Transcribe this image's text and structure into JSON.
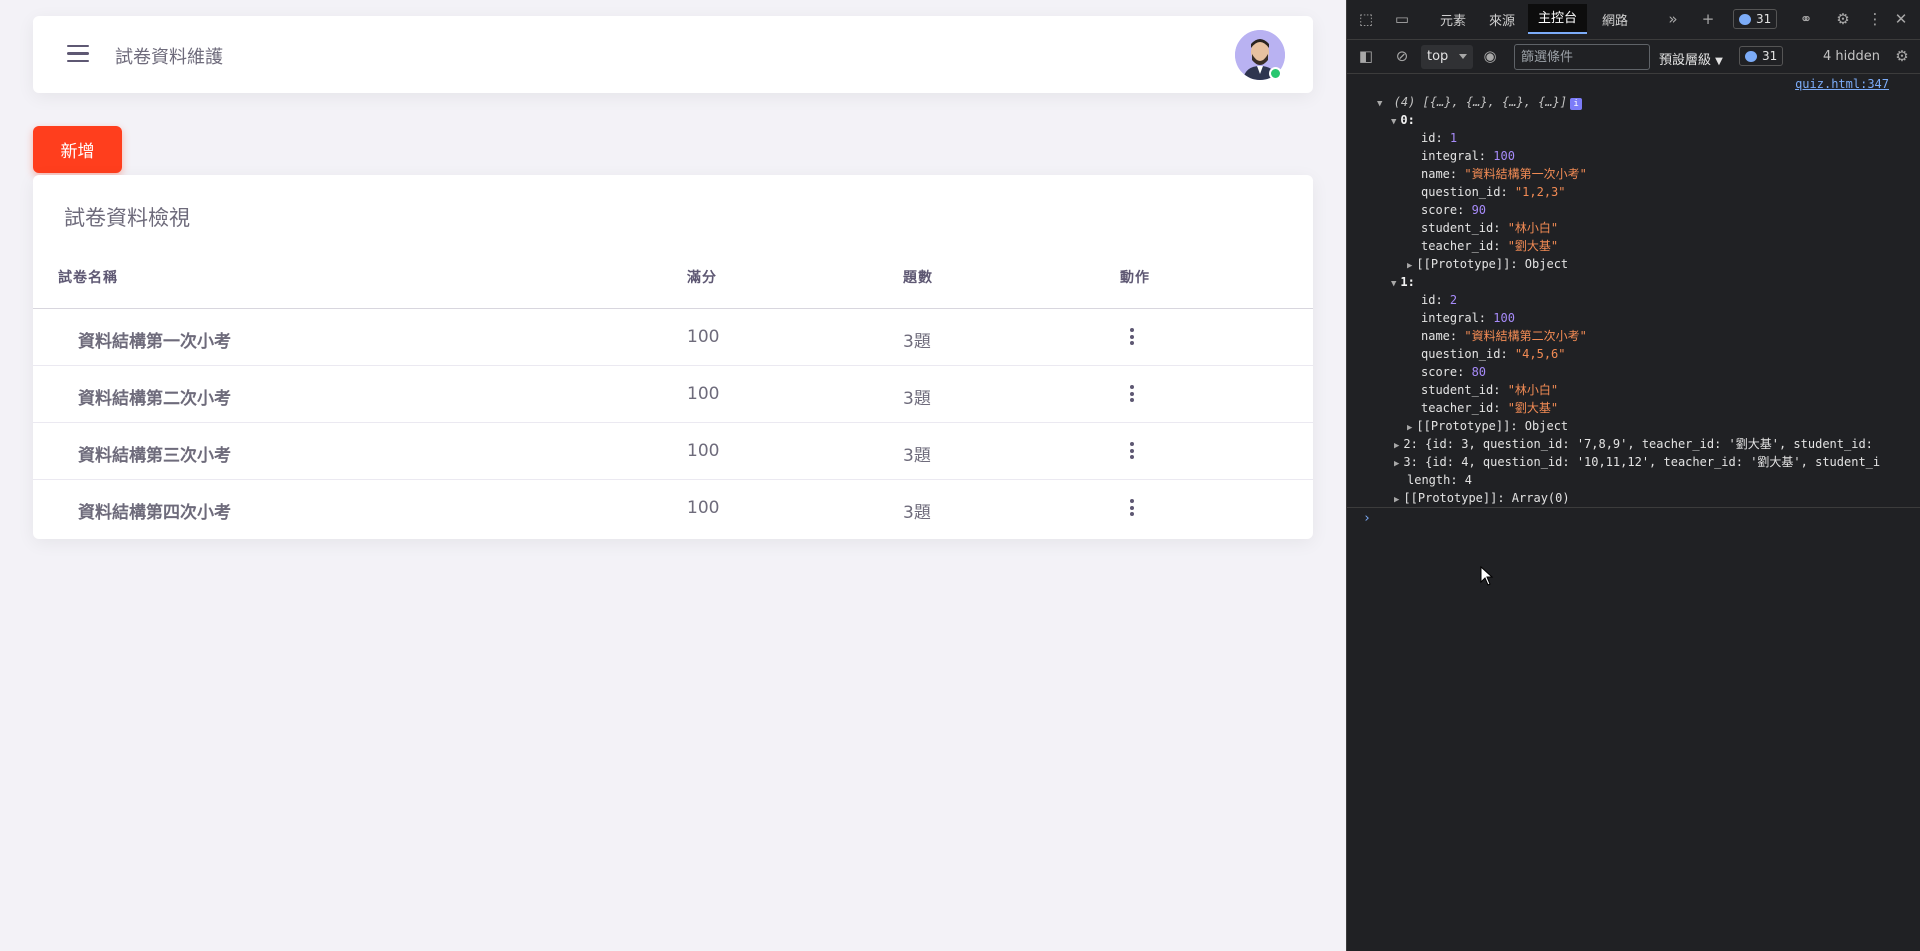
{
  "app": {
    "nav_title": "試卷資料維護",
    "add_button": "新增",
    "card_title": "試卷資料檢視",
    "columns": [
      "試卷名稱",
      "滿分",
      "題數",
      "動作"
    ],
    "rows": [
      {
        "name": "資料結構第一次小考",
        "full_score": "100",
        "count": "3題"
      },
      {
        "name": "資料結構第二次小考",
        "full_score": "100",
        "count": "3題"
      },
      {
        "name": "資料結構第三次小考",
        "full_score": "100",
        "count": "3題"
      },
      {
        "name": "資料結構第四次小考",
        "full_score": "100",
        "count": "3題"
      }
    ],
    "accent_color": "#ff3e1d"
  },
  "devtools": {
    "tabs": [
      "元素",
      "來源",
      "主控台",
      "網路"
    ],
    "active_tab": "主控台",
    "issues_badge": "31",
    "context": "top",
    "filter_placeholder": "篩選條件",
    "levels": "預設層級",
    "levels_badge": "31",
    "hidden": "4 hidden",
    "source_link": "quiz.html:347",
    "console": {
      "summary": "(4) [{…}, {…}, {…}, {…}]",
      "item0_label": "0:",
      "item0": {
        "id": "1",
        "integral": "100",
        "name": "\"資料結構第一次小考\"",
        "question_id": "\"1,2,3\"",
        "score": "90",
        "student_id": "\"林小白\"",
        "teacher_id": "\"劉大基\""
      },
      "item1_label": "1:",
      "item1": {
        "id": "2",
        "integral": "100",
        "name": "\"資料結構第二次小考\"",
        "question_id": "\"4,5,6\"",
        "score": "80",
        "student_id": "\"林小白\"",
        "teacher_id": "\"劉大基\""
      },
      "prototype_object": "[[Prototype]]: Object",
      "item2_line": "2: {id: 3, question_id: '7,8,9', teacher_id: '劉大基', student_id:",
      "item3_line": "3: {id: 4, question_id: '10,11,12', teacher_id: '劉大基', student_i",
      "length_line": "length: 4",
      "prototype_array": "[[Prototype]]: Array(0)"
    }
  }
}
